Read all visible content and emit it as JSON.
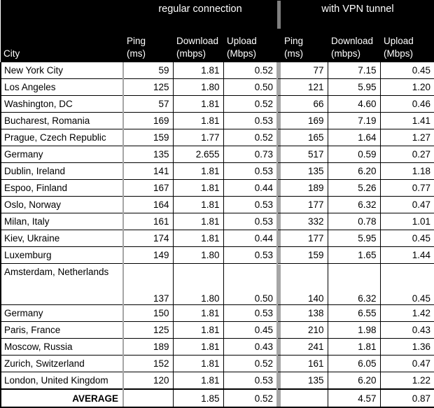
{
  "header": {
    "group_left": "regular connection",
    "group_right": "with VPN tunnel",
    "city_label": "City",
    "columns": [
      {
        "name": "Ping",
        "unit": "(ms)"
      },
      {
        "name": "Download",
        "unit": "(mbps)"
      },
      {
        "name": "Upload",
        "unit": "(Mbps)"
      },
      {
        "name": "Ping",
        "unit": "(ms)"
      },
      {
        "name": "Download",
        "unit": "(mbps)"
      },
      {
        "name": "Upload",
        "unit": "(Mbps)"
      }
    ]
  },
  "colors": {
    "header_bg": "#000000",
    "header_text": "#ffffff",
    "grid": "#000000",
    "section_divider": "#a6a6a6",
    "body_bg": "#ffffff",
    "body_text": "#000000"
  },
  "rows": [
    {
      "city": "New York City",
      "ping1": "59",
      "down1": "1.81",
      "up1": "0.52",
      "ping2": "77",
      "down2": "7.15",
      "up2": "0.45"
    },
    {
      "city": "Los Angeles",
      "ping1": "125",
      "down1": "1.80",
      "up1": "0.50",
      "ping2": "121",
      "down2": "5.95",
      "up2": "1.20"
    },
    {
      "city": "Washington, DC",
      "ping1": "57",
      "down1": "1.81",
      "up1": "0.52",
      "ping2": "66",
      "down2": "4.60",
      "up2": "0.46"
    },
    {
      "city": "Bucharest, Romania",
      "ping1": "169",
      "down1": "1.81",
      "up1": "0.53",
      "ping2": "169",
      "down2": "7.19",
      "up2": "1.41"
    },
    {
      "city": "Prague, Czech Republic",
      "ping1": "159",
      "down1": "1.77",
      "up1": "0.52",
      "ping2": "165",
      "down2": "1.64",
      "up2": "1.27"
    },
    {
      "city": "Germany",
      "ping1": "135",
      "down1": "2.655",
      "up1": "0.73",
      "ping2": "517",
      "down2": "0.59",
      "up2": "0.27"
    },
    {
      "city": "Dublin, Ireland",
      "ping1": "141",
      "down1": "1.81",
      "up1": "0.53",
      "ping2": "135",
      "down2": "6.20",
      "up2": "1.18"
    },
    {
      "city": "Espoo, Finland",
      "ping1": "167",
      "down1": "1.81",
      "up1": "0.44",
      "ping2": "189",
      "down2": "5.26",
      "up2": "0.77"
    },
    {
      "city": "Oslo, Norway",
      "ping1": "164",
      "down1": "1.81",
      "up1": "0.53",
      "ping2": "177",
      "down2": "6.32",
      "up2": "0.47"
    },
    {
      "city": "Milan, Italy",
      "ping1": "161",
      "down1": "1.81",
      "up1": "0.53",
      "ping2": "332",
      "down2": "0.78",
      "up2": "1.01"
    },
    {
      "city": "Kiev, Ukraine",
      "ping1": "174",
      "down1": "1.81",
      "up1": "0.44",
      "ping2": "177",
      "down2": "5.95",
      "up2": "0.45"
    },
    {
      "city": "Luxemburg",
      "ping1": "149",
      "down1": "1.80",
      "up1": "0.53",
      "ping2": "159",
      "down2": "1.65",
      "up2": "1.44"
    },
    {
      "city": "Amsterdam, Netherlands",
      "tall": true,
      "ping1": "137",
      "down1": "1.80",
      "up1": "0.50",
      "ping2": "140",
      "down2": "6.32",
      "up2": "0.45"
    },
    {
      "city": "Germany",
      "ping1": "150",
      "down1": "1.81",
      "up1": "0.53",
      "ping2": "138",
      "down2": "6.55",
      "up2": "1.42"
    },
    {
      "city": "Paris, France",
      "ping1": "125",
      "down1": "1.81",
      "up1": "0.45",
      "ping2": "210",
      "down2": "1.98",
      "up2": "0.43"
    },
    {
      "city": "Moscow, Russia",
      "ping1": "189",
      "down1": "1.81",
      "up1": "0.43",
      "ping2": "241",
      "down2": "1.81",
      "up2": "1.36"
    },
    {
      "city": "Zurich, Switzerland",
      "ping1": "152",
      "down1": "1.81",
      "up1": "0.52",
      "ping2": "161",
      "down2": "6.05",
      "up2": "0.47"
    },
    {
      "city": "London, United Kingdom",
      "ping1": "120",
      "down1": "1.81",
      "up1": "0.53",
      "ping2": "135",
      "down2": "6.20",
      "up2": "1.22"
    }
  ],
  "average": {
    "label": "AVERAGE",
    "ping1": "",
    "down1": "1.85",
    "up1": "0.52",
    "ping2": "",
    "down2": "4.57",
    "up2": "0.87"
  }
}
